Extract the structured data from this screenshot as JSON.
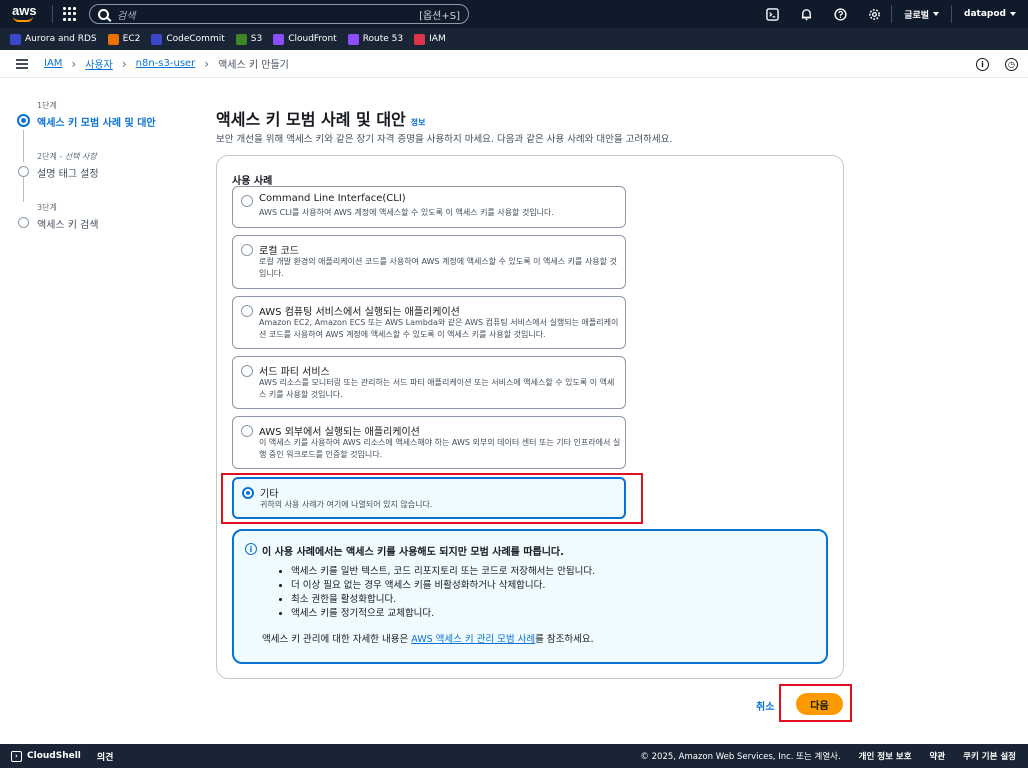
{
  "topnav": {
    "logo_text": "aws",
    "search_placeholder": "검색",
    "search_shortcut": "[옵션+S]",
    "region_menu": "글로벌",
    "account_menu": "datapod",
    "icons": [
      "cloudshell-icon",
      "bell-icon",
      "help-icon",
      "gear-icon"
    ]
  },
  "favorites": [
    {
      "label": "Aurora and RDS",
      "color": "#3b48cc"
    },
    {
      "label": "EC2",
      "color": "#ed7100"
    },
    {
      "label": "CodeCommit",
      "color": "#3b48cc"
    },
    {
      "label": "S3",
      "color": "#3f8624"
    },
    {
      "label": "CloudFront",
      "color": "#8c4fff"
    },
    {
      "label": "Route 53",
      "color": "#8c4fff"
    },
    {
      "label": "IAM",
      "color": "#dd344c"
    }
  ],
  "breadcrumb": [
    "IAM",
    "사용자",
    "n8n-s3-user",
    "액세스 키 만들기"
  ],
  "steps": [
    {
      "num": "1단계",
      "optional": "",
      "title": "액세스 키 모범 사례 및 대안"
    },
    {
      "num": "2단계 - ",
      "optional": "선택 사항",
      "title": "설명 태그 설정"
    },
    {
      "num": "3단계",
      "optional": "",
      "title": "액세스 키 검색"
    }
  ],
  "page": {
    "title": "액세스 키 모범 사례 및 대안",
    "info": "정보",
    "description": "보안 개선을 위해 액세스 키와 같은 장기 자격 증명을 사용하지 마세요. 다음과 같은 사용 사례와 대안을 고려하세요."
  },
  "use_cases": {
    "label": "사용 사례",
    "options": [
      {
        "title": "Command Line Interface(CLI)",
        "desc": "AWS CLI를 사용하여 AWS 계정에 액세스할 수 있도록 이 액세스 키를 사용할 것입니다."
      },
      {
        "title": "로컬 코드",
        "desc": "로컬 개발 환경의 애플리케이션 코드를 사용하여 AWS 계정에 액세스할 수 있도록 이 액세스 키를 사용할 것입니다."
      },
      {
        "title": "AWS 컴퓨팅 서비스에서 실행되는 애플리케이션",
        "desc": "Amazon EC2, Amazon ECS 또는 AWS Lambda와 같은 AWS 컴퓨팅 서비스에서 실행되는 애플리케이션 코드를 사용하여 AWS 계정에 액세스할 수 있도록 이 액세스 키를 사용할 것입니다."
      },
      {
        "title": "서드 파티 서비스",
        "desc": "AWS 리소스를 모니터링 또는 관리하는 서드 파티 애플리케이션 또는 서비스에 액세스할 수 있도록 이 액세스 키를 사용할 것입니다."
      },
      {
        "title": "AWS 외부에서 실행되는 애플리케이션",
        "desc": "이 액세스 키를 사용하여 AWS 리소스에 액세스해야 하는 AWS 외부의 데이터 센터 또는 기타 인프라에서 실행 중인 워크로드를 인증할 것입니다."
      },
      {
        "title": "기타",
        "desc": "귀하의 사용 사례가 여기에 나열되어 있지 않습니다."
      }
    ],
    "selected": "기타"
  },
  "alert": {
    "title": "이 사용 사례에서는 액세스 키를 사용해도 되지만 모범 사례를 따릅니다.",
    "bullets": [
      "액세스 키를 일반 텍스트, 코드 리포지토리 또는 코드로 저장해서는 안됩니다.",
      "더 이상 필요 없는 경우 액세스 키를 비활성화하거나 삭제합니다.",
      "최소 권한을 활성화합니다.",
      "액세스 키를 정기적으로 교체합니다."
    ],
    "more_prefix": "액세스 키 관리에 대한 자세한 내용은 ",
    "more_link": "AWS 액세스 키 관리 모범 사례",
    "more_suffix": "를 참조하세요."
  },
  "actions": {
    "cancel": "취소",
    "next": "다음"
  },
  "footer": {
    "cloudshell": "CloudShell",
    "feedback": "의견",
    "copyright": "© 2025, Amazon Web Services, Inc. 또는 계열사.",
    "privacy": "개인 정보 보호",
    "terms": "약관",
    "cookies": "쿠키 기본 설정"
  }
}
